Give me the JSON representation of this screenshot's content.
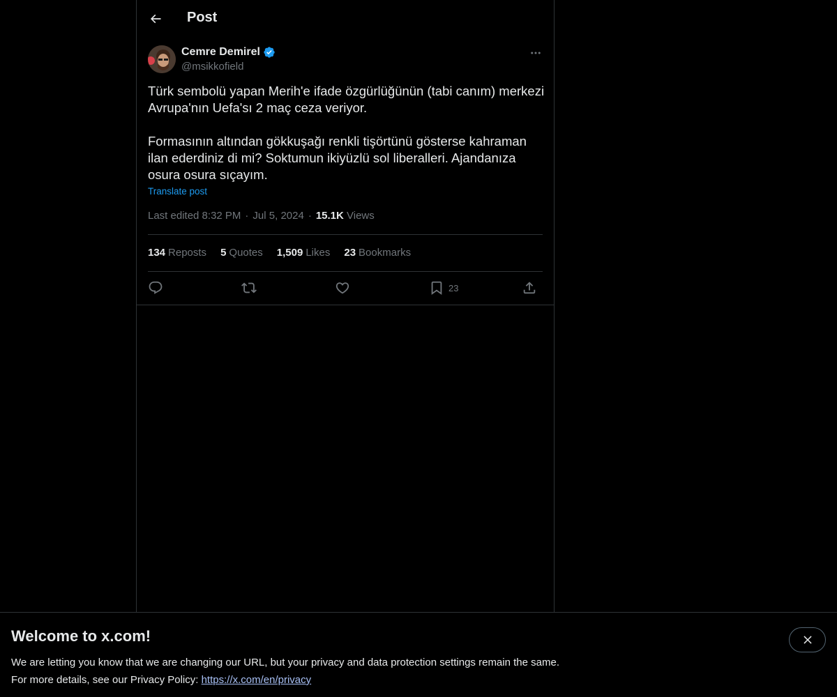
{
  "header": {
    "title": "Post"
  },
  "author": {
    "name": "Cemre Demirel",
    "handle": "@msikkofield"
  },
  "post": {
    "text": "Türk sembolü yapan Merih'e ifade özgürlüğünün (tabi canım) merkezi Avrupa'nın Uefa'sı 2 maç ceza veriyor.\n\nFormasının altından gökkuşağı renkli tişörtünü gösterse kahraman ilan ederdiniz di mi? Soktumun ikiyüzlü sol liberalleri. Ajandanıza osura osura sıçayım.",
    "translate_label": "Translate post",
    "edited_label": "Last edited 8:32 PM",
    "date": "Jul 5, 2024",
    "views_count": "15.1K",
    "views_label": "Views"
  },
  "stats": {
    "reposts": {
      "count": "134",
      "label": "Reposts"
    },
    "quotes": {
      "count": "5",
      "label": "Quotes"
    },
    "likes": {
      "count": "1,509",
      "label": "Likes"
    },
    "bookmarks": {
      "count": "23",
      "label": "Bookmarks"
    }
  },
  "actions": {
    "bookmark_count": "23"
  },
  "banner": {
    "title": "Welcome to x.com!",
    "line1": "We are letting you know that we are changing our URL, but your privacy and data protection settings remain the same.",
    "line2_prefix": "For more details, see our Privacy Policy: ",
    "link": "https://x.com/en/privacy"
  },
  "colors": {
    "background": "#000000",
    "text": "#e7e9ea",
    "muted": "#71767b",
    "accent": "#1d9bf0",
    "border": "#2f3336"
  },
  "icons": [
    "back-arrow-icon",
    "verified-badge-icon",
    "more-icon",
    "reply-icon",
    "repost-icon",
    "like-icon",
    "bookmark-icon",
    "share-icon",
    "close-icon"
  ]
}
